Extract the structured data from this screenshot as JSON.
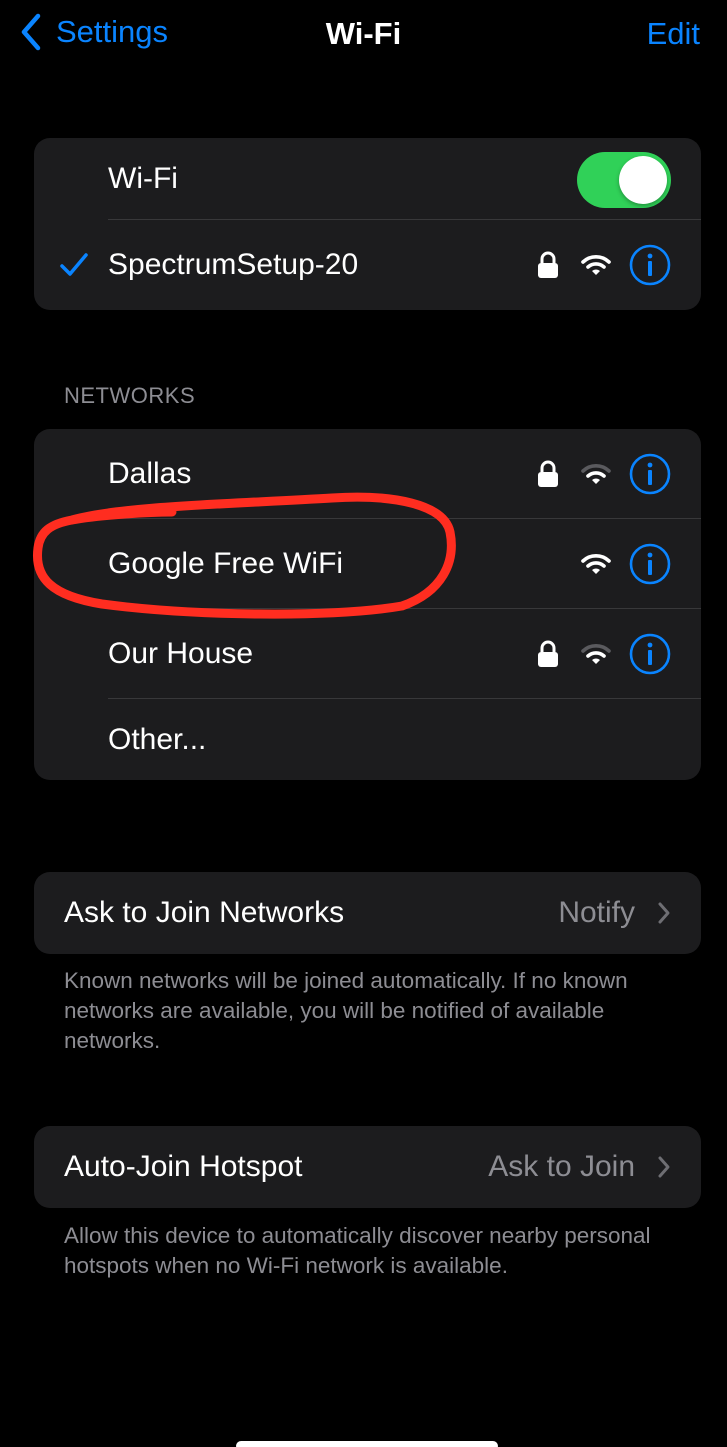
{
  "nav": {
    "back_label": "Settings",
    "title": "Wi-Fi",
    "edit_label": "Edit"
  },
  "wifi_card": {
    "toggle_label": "Wi-Fi",
    "toggle_on": true,
    "connected_network": "SpectrumSetup-20"
  },
  "networks": {
    "header": "NETWORKS",
    "items": [
      {
        "name": "Dallas",
        "locked": true
      },
      {
        "name": "Google Free WiFi",
        "locked": false
      },
      {
        "name": "Our House",
        "locked": true
      },
      {
        "name": "Other...",
        "locked": false
      }
    ]
  },
  "ask_to_join": {
    "label": "Ask to Join Networks",
    "value": "Notify",
    "footnote": "Known networks will be joined automatically. If no known networks are available, you will be notified of available networks."
  },
  "auto_join": {
    "label": "Auto-Join Hotspot",
    "value": "Ask to Join",
    "footnote": "Allow this device to automatically discover nearby personal hotspots when no Wi-Fi network is available."
  },
  "colors": {
    "accent": "#0a84ff",
    "toggle_on": "#30d158",
    "annotation": "#ff2d20",
    "card_bg": "#1c1c1e",
    "secondary_text": "#8d8d93"
  }
}
